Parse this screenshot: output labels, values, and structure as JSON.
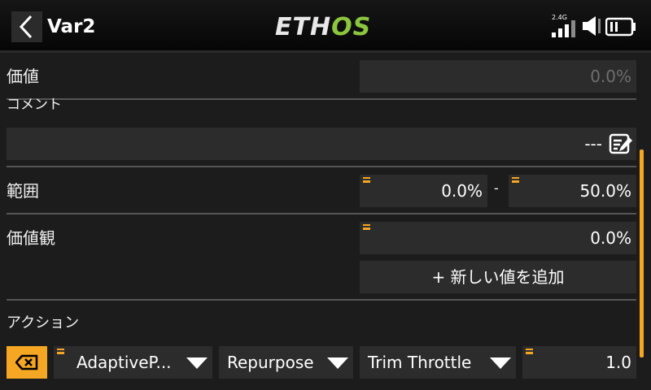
{
  "header": {
    "title": "Var2",
    "logo_left": "ETH",
    "logo_right": "OS",
    "rf_band": "2.4G"
  },
  "colors": {
    "accent": "#f5a623",
    "logo_green": "#8cc63f",
    "panel": "#2c2c2c"
  },
  "rows": {
    "value": {
      "label": "価値",
      "value": "0.0%"
    },
    "comment": {
      "label": "コメント",
      "value": "---"
    },
    "range": {
      "label": "範囲",
      "min": "0.0%",
      "separator": "-",
      "max": "50.0%"
    },
    "values": {
      "label": "価値観",
      "value": "0.0%",
      "add_label": "+ 新しい値を追加"
    },
    "action": {
      "label": "アクション",
      "source": "AdaptiveP...",
      "type": "Repurpose",
      "target": "Trim Throttle",
      "amount": "1.0"
    }
  }
}
